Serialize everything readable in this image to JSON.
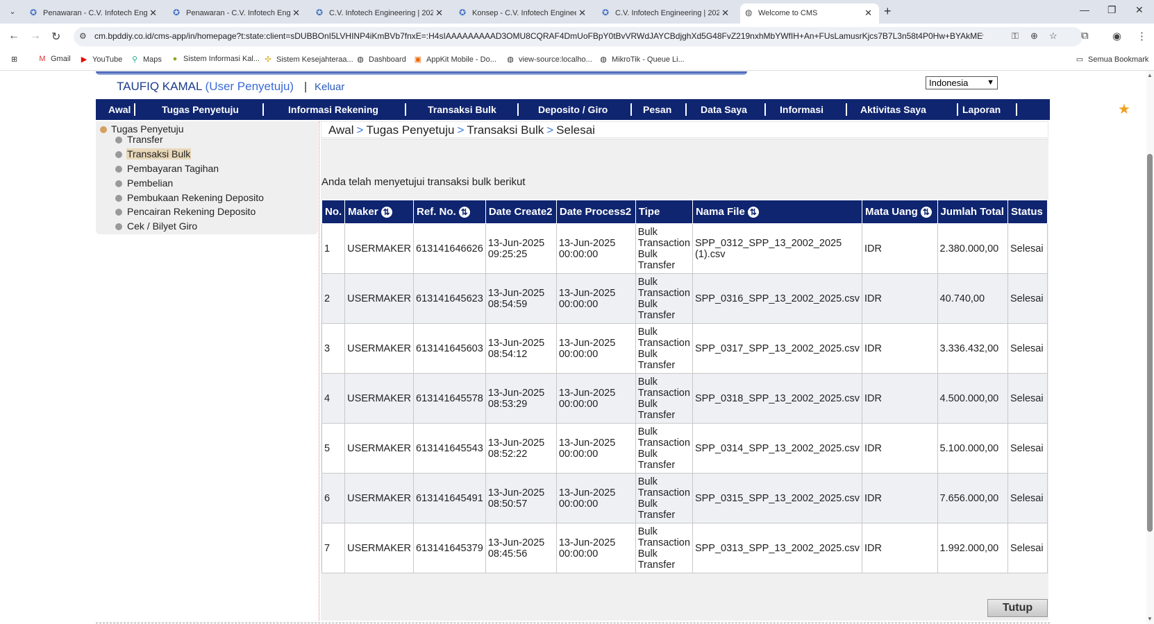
{
  "browser": {
    "tabs": [
      {
        "title": "Penawaran - C.V. Infotech Engi"
      },
      {
        "title": "Penawaran - C.V. Infotech Engi"
      },
      {
        "title": "C.V. Infotech Engineering | 202"
      },
      {
        "title": "Konsep - C.V. Infotech Enginee"
      },
      {
        "title": "C.V. Infotech Engineering | 202"
      },
      {
        "title": "Welcome to CMS"
      }
    ],
    "url": "cm.bpddiy.co.id/cms-app/in/homepage?t:state:client=sDUBBOnI5LVHINP4iKmBVb7fnxE=:H4sIAAAAAAAAAD3OMU8CQRAF4DmUoFBpY0tBvVRWdJAYCBdjghXd5G48FvZ219nxhMbYWfIH+An+FUsLamusrKjcs7B7L3n58t4P0Hw+BYAkMEwdFwo9Z...",
    "bookmarks": [
      {
        "label": "Gmail"
      },
      {
        "label": "YouTube"
      },
      {
        "label": "Maps"
      },
      {
        "label": "Sistem Informasi Kal..."
      },
      {
        "label": "Sistem Kesejahteraa..."
      },
      {
        "label": "Dashboard"
      },
      {
        "label": "AppKit Mobile - Do..."
      },
      {
        "label": "view-source:localho..."
      },
      {
        "label": "MikroTik - Queue Li..."
      },
      {
        "label": "Semua Bookmark"
      }
    ]
  },
  "header": {
    "user_name": "TAUFIQ KAMAL",
    "user_role": "(User Penyetuju)",
    "logout": "Keluar",
    "language": "Indonesia"
  },
  "menu": [
    {
      "label": "Awal"
    },
    {
      "label": "Tugas Penyetuju"
    },
    {
      "label": "Informasi Rekening"
    },
    {
      "label": "Transaksi Bulk"
    },
    {
      "label": "Deposito / Giro"
    },
    {
      "label": "Pesan"
    },
    {
      "label": "Data Saya"
    },
    {
      "label": "Informasi"
    },
    {
      "label": "Aktivitas Saya"
    },
    {
      "label": "Laporan"
    }
  ],
  "sidebar": {
    "root": "Tugas Penyetuju",
    "items": [
      {
        "label": "Transfer"
      },
      {
        "label": "Transaksi Bulk"
      },
      {
        "label": "Pembayaran Tagihan"
      },
      {
        "label": "Pembelian"
      },
      {
        "label": "Pembukaan Rekening Deposito"
      },
      {
        "label": "Pencairan Rekening Deposito"
      },
      {
        "label": "Cek / Bilyet Giro"
      }
    ]
  },
  "breadcrumb": [
    "Awal",
    "Tugas Penyetuju",
    "Transaksi Bulk",
    "Selesai"
  ],
  "intro": "Anda telah menyetujui transaksi bulk berikut",
  "table": {
    "columns": [
      "No.",
      "Maker",
      "Ref. No.",
      "Date Create2",
      "Date Process2",
      "Tipe",
      "Nama File",
      "Mata Uang",
      "Jumlah Total",
      "Status"
    ],
    "rows": [
      {
        "no": "1",
        "maker": "USERMAKER",
        "ref": "613141646626",
        "create_date": "13-Jun-2025",
        "create_time": "09:25:25",
        "process_date": "13-Jun-2025",
        "process_time": "00:00:00",
        "tipe1": "Bulk Transaction",
        "tipe2": "Bulk Transfer",
        "file": "SPP_0312_SPP_13_2002_2025 (1).csv",
        "currency": "IDR",
        "total": "2.380.000,00",
        "status": "Selesai"
      },
      {
        "no": "2",
        "maker": "USERMAKER",
        "ref": "613141645623",
        "create_date": "13-Jun-2025",
        "create_time": "08:54:59",
        "process_date": "13-Jun-2025",
        "process_time": "00:00:00",
        "tipe1": "Bulk Transaction",
        "tipe2": "Bulk Transfer",
        "file": "SPP_0316_SPP_13_2002_2025.csv",
        "currency": "IDR",
        "total": "40.740,00",
        "status": "Selesai"
      },
      {
        "no": "3",
        "maker": "USERMAKER",
        "ref": "613141645603",
        "create_date": "13-Jun-2025",
        "create_time": "08:54:12",
        "process_date": "13-Jun-2025",
        "process_time": "00:00:00",
        "tipe1": "Bulk Transaction",
        "tipe2": "Bulk Transfer",
        "file": "SPP_0317_SPP_13_2002_2025.csv",
        "currency": "IDR",
        "total": "3.336.432,00",
        "status": "Selesai"
      },
      {
        "no": "4",
        "maker": "USERMAKER",
        "ref": "613141645578",
        "create_date": "13-Jun-2025",
        "create_time": "08:53:29",
        "process_date": "13-Jun-2025",
        "process_time": "00:00:00",
        "tipe1": "Bulk Transaction",
        "tipe2": "Bulk Transfer",
        "file": "SPP_0318_SPP_13_2002_2025.csv",
        "currency": "IDR",
        "total": "4.500.000,00",
        "status": "Selesai"
      },
      {
        "no": "5",
        "maker": "USERMAKER",
        "ref": "613141645543",
        "create_date": "13-Jun-2025",
        "create_time": "08:52:22",
        "process_date": "13-Jun-2025",
        "process_time": "00:00:00",
        "tipe1": "Bulk Transaction",
        "tipe2": "Bulk Transfer",
        "file": "SPP_0314_SPP_13_2002_2025.csv",
        "currency": "IDR",
        "total": "5.100.000,00",
        "status": "Selesai"
      },
      {
        "no": "6",
        "maker": "USERMAKER",
        "ref": "613141645491",
        "create_date": "13-Jun-2025",
        "create_time": "08:50:57",
        "process_date": "13-Jun-2025",
        "process_time": "00:00:00",
        "tipe1": "Bulk Transaction",
        "tipe2": "Bulk Transfer",
        "file": "SPP_0315_SPP_13_2002_2025.csv",
        "currency": "IDR",
        "total": "7.656.000,00",
        "status": "Selesai"
      },
      {
        "no": "7",
        "maker": "USERMAKER",
        "ref": "613141645379",
        "create_date": "13-Jun-2025",
        "create_time": "08:45:56",
        "process_date": "13-Jun-2025",
        "process_time": "00:00:00",
        "tipe1": "Bulk Transaction",
        "tipe2": "Bulk Transfer",
        "file": "SPP_0313_SPP_13_2002_2025.csv",
        "currency": "IDR",
        "total": "1.992.000,00",
        "status": "Selesai"
      }
    ]
  },
  "close_button": "Tutup",
  "colors": {
    "menu_bg": "#0f2570",
    "accent_link": "#3a7ad8",
    "star": "#f0a020"
  }
}
